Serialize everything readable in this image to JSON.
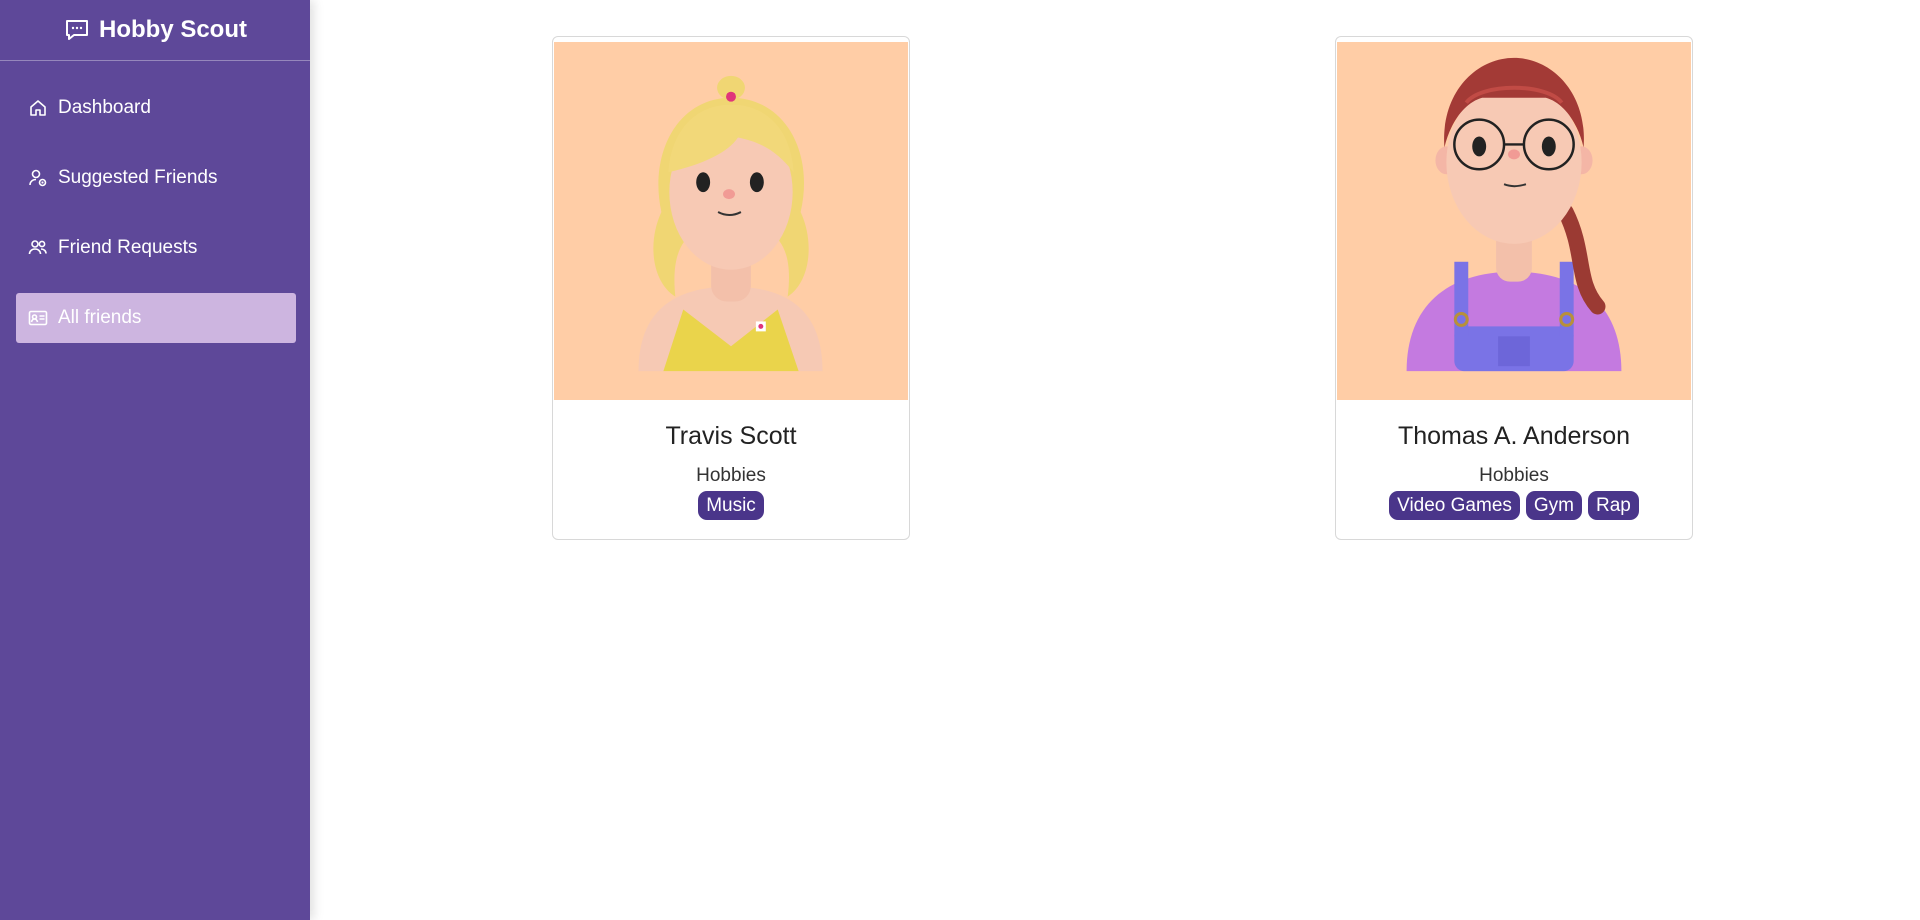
{
  "brand": {
    "title": "Hobby Scout",
    "icon": "chat-bubble-icon"
  },
  "sidebar": {
    "items": [
      {
        "label": "Dashboard",
        "icon": "home-icon",
        "active": false
      },
      {
        "label": "Suggested Friends",
        "icon": "user-suggest-icon",
        "active": false
      },
      {
        "label": "Friend Requests",
        "icon": "users-icon",
        "active": false
      },
      {
        "label": "All friends",
        "icon": "id-card-icon",
        "active": true
      }
    ]
  },
  "friends": [
    {
      "name": "Travis Scott",
      "hobbies_label": "Hobbies",
      "hobbies": [
        "Music"
      ],
      "avatar": "blonde-avatar-illustration"
    },
    {
      "name": "Thomas A. Anderson",
      "hobbies_label": "Hobbies",
      "hobbies": [
        "Video Games",
        "Gym",
        "Rap"
      ],
      "avatar": "glasses-avatar-illustration"
    }
  ],
  "colors": {
    "sidebar": "#5e4899",
    "active_item": "#cdb5e0",
    "tag": "#4a358a",
    "avatar_bg": "#ffcda6"
  }
}
